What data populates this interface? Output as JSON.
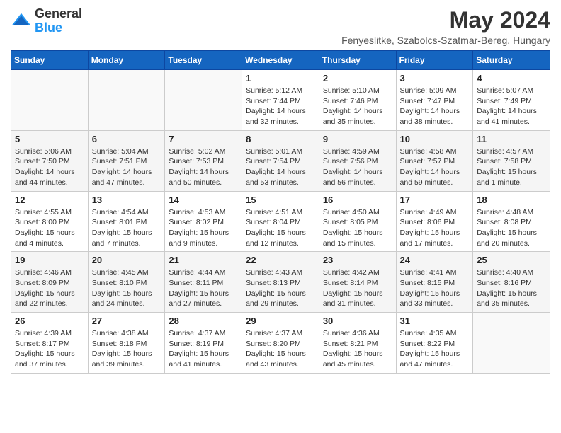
{
  "header": {
    "logo_line1": "General",
    "logo_line2": "Blue",
    "month_year": "May 2024",
    "location": "Fenyeslitke, Szabolcs-Szatmar-Bereg, Hungary"
  },
  "weekdays": [
    "Sunday",
    "Monday",
    "Tuesday",
    "Wednesday",
    "Thursday",
    "Friday",
    "Saturday"
  ],
  "weeks": [
    [
      {
        "day": "",
        "info": ""
      },
      {
        "day": "",
        "info": ""
      },
      {
        "day": "",
        "info": ""
      },
      {
        "day": "1",
        "info": "Sunrise: 5:12 AM\nSunset: 7:44 PM\nDaylight: 14 hours\nand 32 minutes."
      },
      {
        "day": "2",
        "info": "Sunrise: 5:10 AM\nSunset: 7:46 PM\nDaylight: 14 hours\nand 35 minutes."
      },
      {
        "day": "3",
        "info": "Sunrise: 5:09 AM\nSunset: 7:47 PM\nDaylight: 14 hours\nand 38 minutes."
      },
      {
        "day": "4",
        "info": "Sunrise: 5:07 AM\nSunset: 7:49 PM\nDaylight: 14 hours\nand 41 minutes."
      }
    ],
    [
      {
        "day": "5",
        "info": "Sunrise: 5:06 AM\nSunset: 7:50 PM\nDaylight: 14 hours\nand 44 minutes."
      },
      {
        "day": "6",
        "info": "Sunrise: 5:04 AM\nSunset: 7:51 PM\nDaylight: 14 hours\nand 47 minutes."
      },
      {
        "day": "7",
        "info": "Sunrise: 5:02 AM\nSunset: 7:53 PM\nDaylight: 14 hours\nand 50 minutes."
      },
      {
        "day": "8",
        "info": "Sunrise: 5:01 AM\nSunset: 7:54 PM\nDaylight: 14 hours\nand 53 minutes."
      },
      {
        "day": "9",
        "info": "Sunrise: 4:59 AM\nSunset: 7:56 PM\nDaylight: 14 hours\nand 56 minutes."
      },
      {
        "day": "10",
        "info": "Sunrise: 4:58 AM\nSunset: 7:57 PM\nDaylight: 14 hours\nand 59 minutes."
      },
      {
        "day": "11",
        "info": "Sunrise: 4:57 AM\nSunset: 7:58 PM\nDaylight: 15 hours\nand 1 minute."
      }
    ],
    [
      {
        "day": "12",
        "info": "Sunrise: 4:55 AM\nSunset: 8:00 PM\nDaylight: 15 hours\nand 4 minutes."
      },
      {
        "day": "13",
        "info": "Sunrise: 4:54 AM\nSunset: 8:01 PM\nDaylight: 15 hours\nand 7 minutes."
      },
      {
        "day": "14",
        "info": "Sunrise: 4:53 AM\nSunset: 8:02 PM\nDaylight: 15 hours\nand 9 minutes."
      },
      {
        "day": "15",
        "info": "Sunrise: 4:51 AM\nSunset: 8:04 PM\nDaylight: 15 hours\nand 12 minutes."
      },
      {
        "day": "16",
        "info": "Sunrise: 4:50 AM\nSunset: 8:05 PM\nDaylight: 15 hours\nand 15 minutes."
      },
      {
        "day": "17",
        "info": "Sunrise: 4:49 AM\nSunset: 8:06 PM\nDaylight: 15 hours\nand 17 minutes."
      },
      {
        "day": "18",
        "info": "Sunrise: 4:48 AM\nSunset: 8:08 PM\nDaylight: 15 hours\nand 20 minutes."
      }
    ],
    [
      {
        "day": "19",
        "info": "Sunrise: 4:46 AM\nSunset: 8:09 PM\nDaylight: 15 hours\nand 22 minutes."
      },
      {
        "day": "20",
        "info": "Sunrise: 4:45 AM\nSunset: 8:10 PM\nDaylight: 15 hours\nand 24 minutes."
      },
      {
        "day": "21",
        "info": "Sunrise: 4:44 AM\nSunset: 8:11 PM\nDaylight: 15 hours\nand 27 minutes."
      },
      {
        "day": "22",
        "info": "Sunrise: 4:43 AM\nSunset: 8:13 PM\nDaylight: 15 hours\nand 29 minutes."
      },
      {
        "day": "23",
        "info": "Sunrise: 4:42 AM\nSunset: 8:14 PM\nDaylight: 15 hours\nand 31 minutes."
      },
      {
        "day": "24",
        "info": "Sunrise: 4:41 AM\nSunset: 8:15 PM\nDaylight: 15 hours\nand 33 minutes."
      },
      {
        "day": "25",
        "info": "Sunrise: 4:40 AM\nSunset: 8:16 PM\nDaylight: 15 hours\nand 35 minutes."
      }
    ],
    [
      {
        "day": "26",
        "info": "Sunrise: 4:39 AM\nSunset: 8:17 PM\nDaylight: 15 hours\nand 37 minutes."
      },
      {
        "day": "27",
        "info": "Sunrise: 4:38 AM\nSunset: 8:18 PM\nDaylight: 15 hours\nand 39 minutes."
      },
      {
        "day": "28",
        "info": "Sunrise: 4:37 AM\nSunset: 8:19 PM\nDaylight: 15 hours\nand 41 minutes."
      },
      {
        "day": "29",
        "info": "Sunrise: 4:37 AM\nSunset: 8:20 PM\nDaylight: 15 hours\nand 43 minutes."
      },
      {
        "day": "30",
        "info": "Sunrise: 4:36 AM\nSunset: 8:21 PM\nDaylight: 15 hours\nand 45 minutes."
      },
      {
        "day": "31",
        "info": "Sunrise: 4:35 AM\nSunset: 8:22 PM\nDaylight: 15 hours\nand 47 minutes."
      },
      {
        "day": "",
        "info": ""
      }
    ]
  ]
}
